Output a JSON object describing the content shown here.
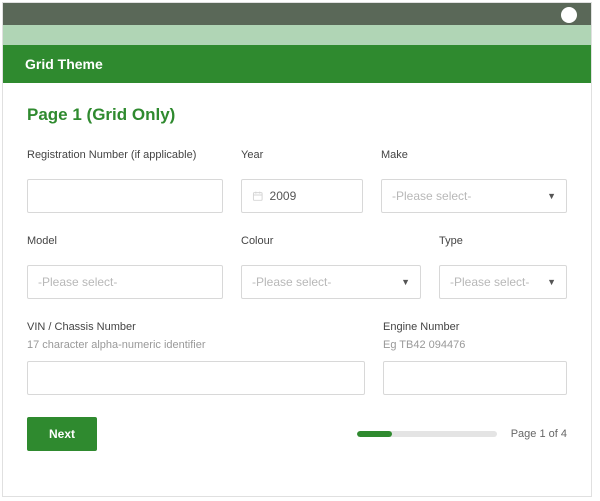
{
  "header": {
    "title": "Grid Theme"
  },
  "page": {
    "title": "Page 1 (Grid Only)"
  },
  "fields": {
    "registration": {
      "label": "Registration Number (if applicable)",
      "value": ""
    },
    "year": {
      "label": "Year",
      "value": "2009"
    },
    "make": {
      "label": "Make",
      "placeholder": "-Please select-"
    },
    "model": {
      "label": "Model",
      "placeholder": "-Please select-"
    },
    "colour": {
      "label": "Colour",
      "placeholder": "-Please select-"
    },
    "type": {
      "label": "Type",
      "placeholder": "-Please select-"
    },
    "vin": {
      "label": "VIN / Chassis Number",
      "hint": "17 character alpha-numeric identifier",
      "value": ""
    },
    "engine": {
      "label": "Engine Number",
      "hint": "Eg TB42 094476",
      "value": ""
    }
  },
  "footer": {
    "next_label": "Next",
    "page_indicator": "Page 1 of 4",
    "progress_percent": 25
  }
}
